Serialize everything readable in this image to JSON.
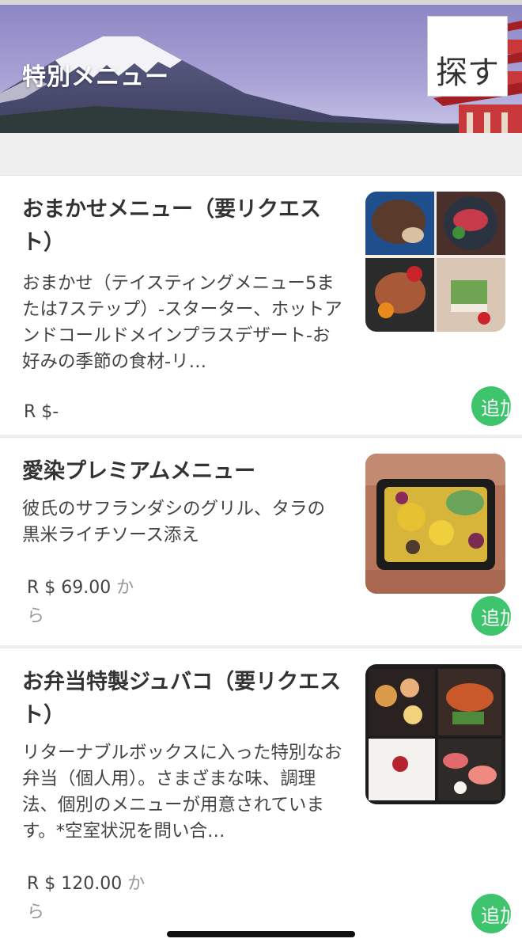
{
  "header": {
    "title": "特別メニュー",
    "search_label": "探す"
  },
  "items": [
    {
      "title": "おまかせメニュー（要リクエスト）",
      "description": "おまかせ（テイスティングメニュー5または7ステップ）-スターター、ホットアンドコールドメインプラスデザート-お好みの季節の食材-リ…",
      "price": "R $-",
      "price_suffix": "",
      "add_label": "追加"
    },
    {
      "title": "愛染プレミアムメニュー",
      "description": "彼氏のサフランダシのグリル、タラの黒米ライチソース添え",
      "price": "R $ 69.00",
      "price_suffix": "から",
      "add_label": "追加"
    },
    {
      "title": "お弁当特製ジュバコ（要リクエスト）",
      "description": "リターナブルボックスに入った特別なお弁当（個人用）。さまざまな味、調理法、個別のメニューが用意されています。*空室状況を問い合…",
      "price": "R $ 120.00",
      "price_suffix": "から",
      "add_label": "追加"
    }
  ],
  "colors": {
    "accent": "#3ec46d",
    "background": "#efefef",
    "card": "#ffffff",
    "text": "#333333"
  },
  "icons": {
    "add": "add-button-circle",
    "banner_image": "mount-fuji-pagoda-photo"
  }
}
